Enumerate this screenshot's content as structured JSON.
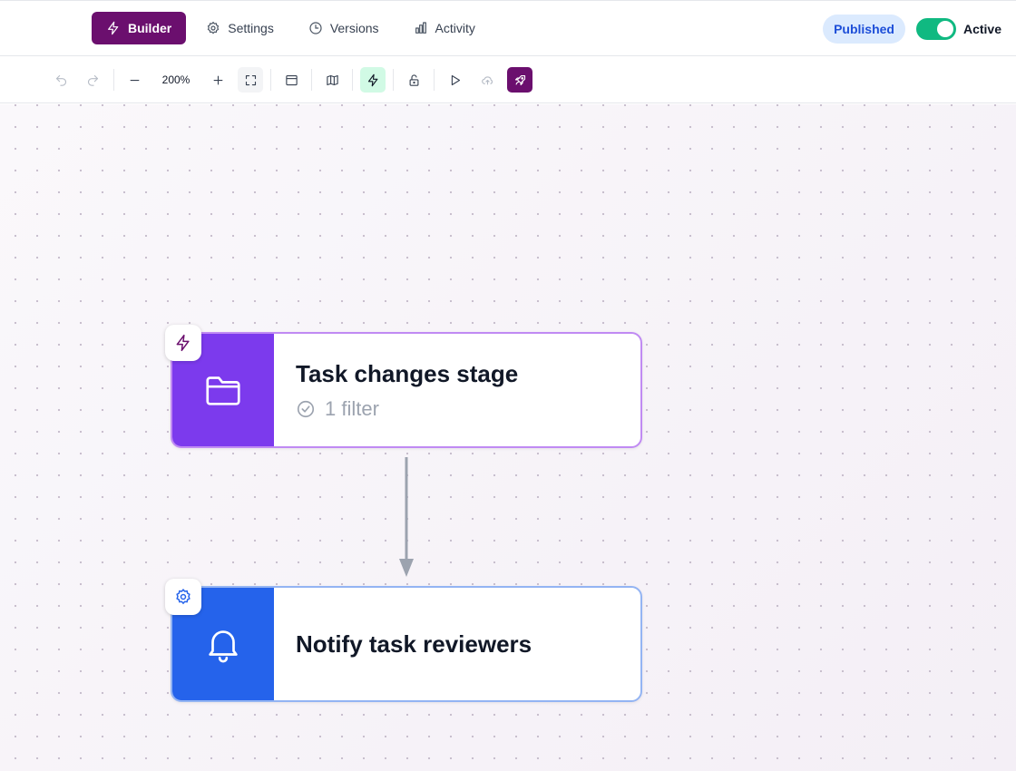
{
  "nav": {
    "tabs": [
      {
        "label": "Builder",
        "icon": "bolt-icon",
        "active": true
      },
      {
        "label": "Settings",
        "icon": "gear-icon"
      },
      {
        "label": "Versions",
        "icon": "clock-icon"
      },
      {
        "label": "Activity",
        "icon": "bar-chart-icon"
      }
    ]
  },
  "status": {
    "badge": "Published",
    "toggle_label": "Active",
    "toggle_on": true
  },
  "toolbar": {
    "zoom": "200%",
    "tools": [
      "undo-icon",
      "redo-icon",
      "zoom-out-icon",
      "zoom-in-icon",
      "fit-view-icon",
      "panel-icon",
      "map-icon",
      "bolt-icon",
      "lock-icon",
      "play-icon",
      "cloud-upload-icon",
      "rocket-icon"
    ]
  },
  "flow": {
    "trigger": {
      "title": "Task changes stage",
      "subtitle": "1 filter",
      "icon": "folder-icon",
      "badge_icon": "bolt-icon"
    },
    "action": {
      "title": "Notify task reviewers",
      "icon": "bell-icon",
      "badge_icon": "gear-icon"
    }
  },
  "colors": {
    "brand": "#6b0f6e",
    "trigger": "#7c3aed",
    "action": "#2563eb",
    "active_toggle": "#10b981",
    "badge_bg": "#dbeafe",
    "badge_text": "#1d4ed8"
  }
}
